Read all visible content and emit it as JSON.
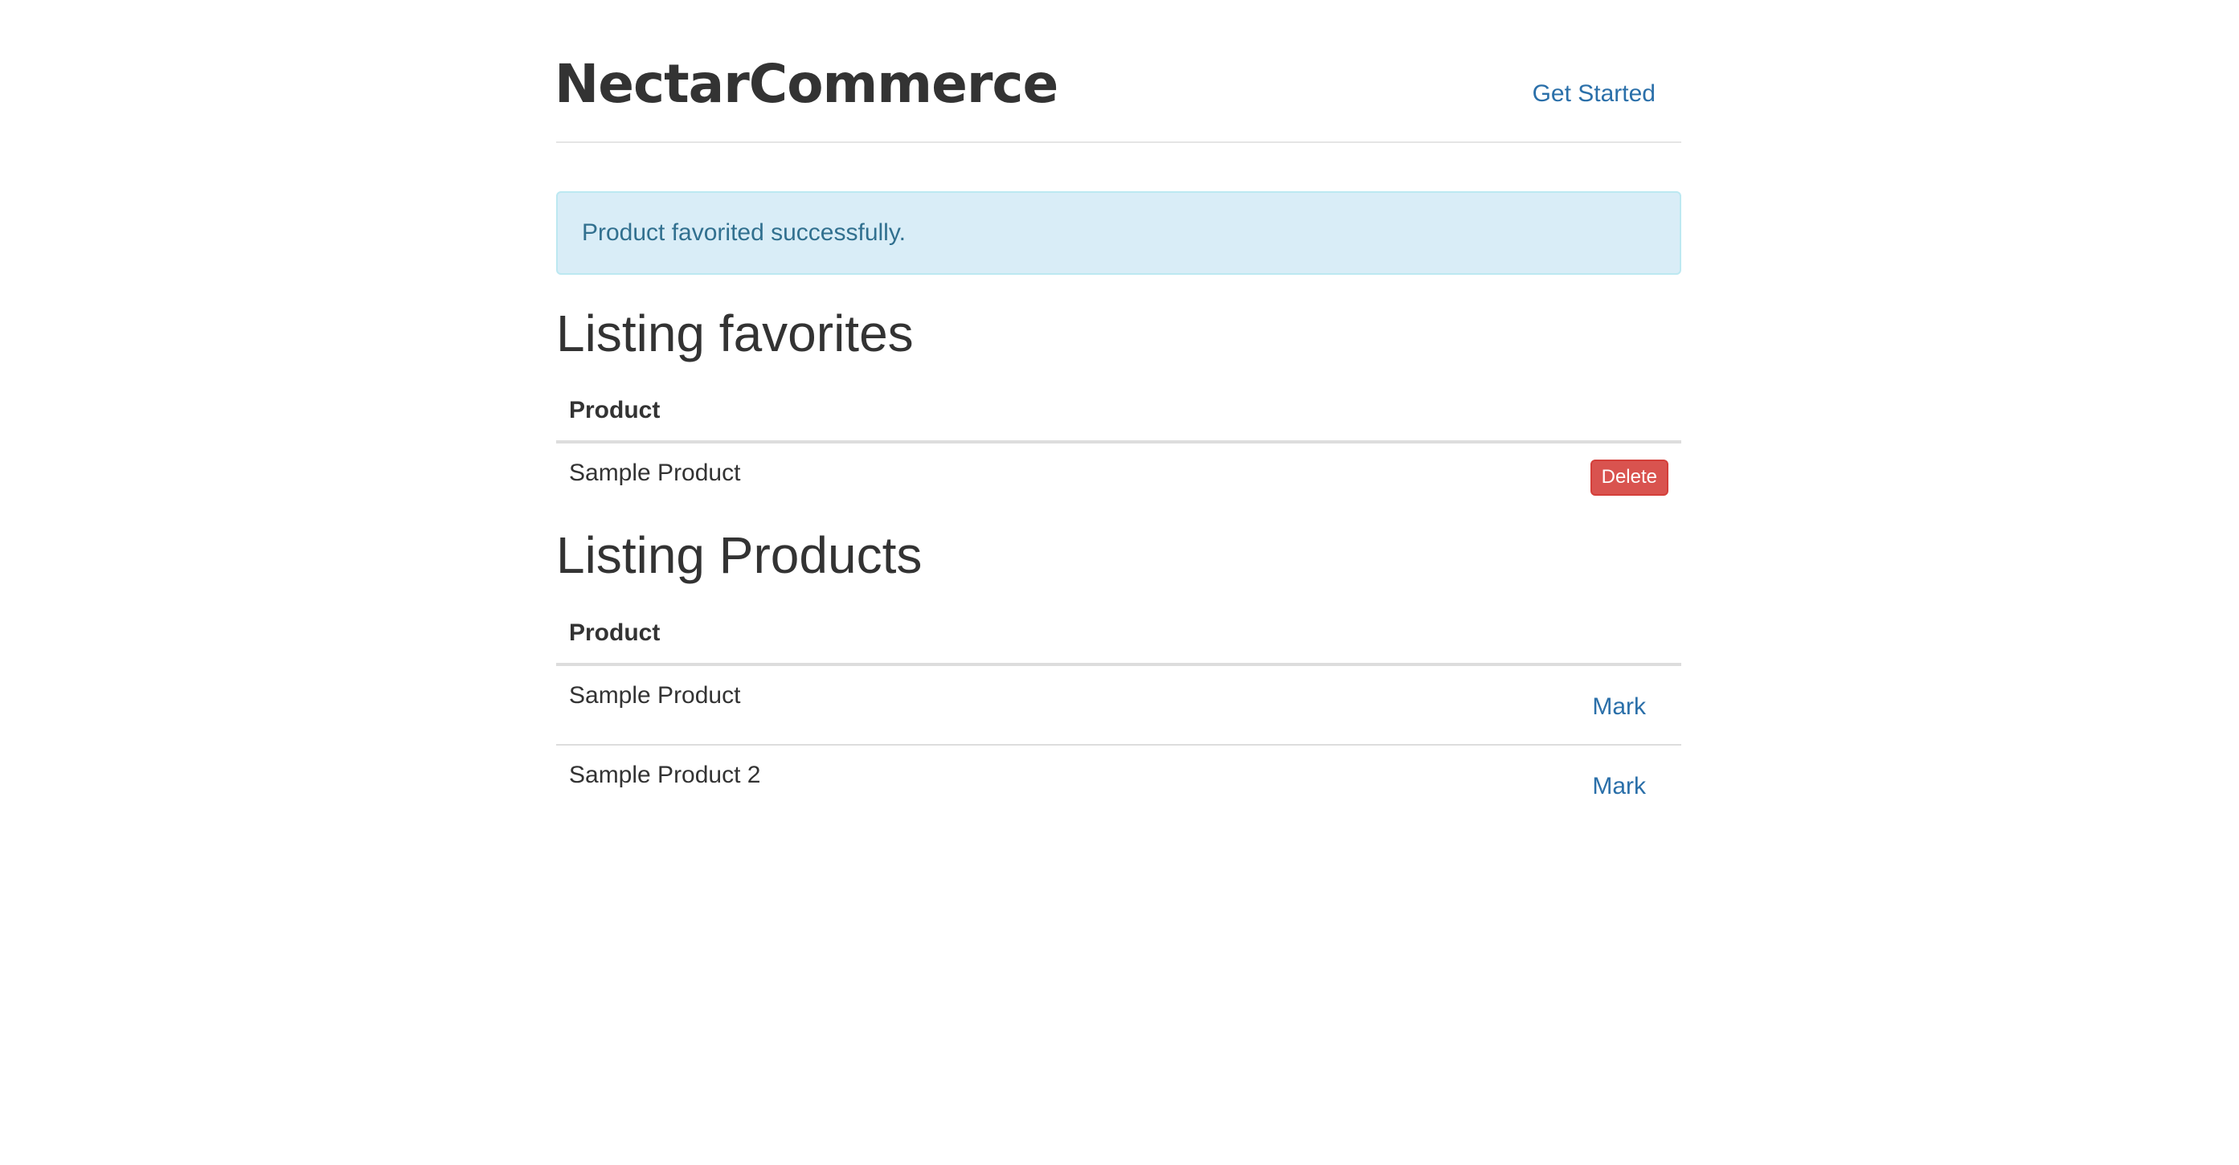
{
  "header": {
    "brand": "NectarCommerce",
    "nav_link": "Get Started"
  },
  "alert": {
    "message": "Product favorited successfully."
  },
  "favorites": {
    "title": "Listing favorites",
    "column_header": "Product",
    "rows": [
      {
        "product": "Sample Product",
        "action": "Delete"
      }
    ]
  },
  "products": {
    "title": "Listing Products",
    "column_header": "Product",
    "rows": [
      {
        "product": "Sample Product",
        "action": "Mark"
      },
      {
        "product": "Sample Product 2",
        "action": "Mark"
      }
    ]
  },
  "colors": {
    "link": "#2a6fa9",
    "alert_bg": "#d9edf7",
    "alert_text": "#31708f",
    "danger": "#d9534f"
  }
}
